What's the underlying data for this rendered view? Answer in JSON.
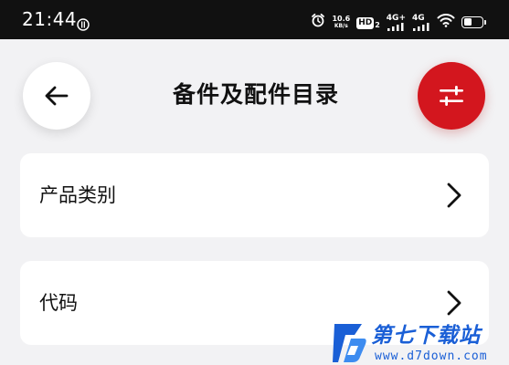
{
  "status_bar": {
    "time": "21:44",
    "net_speed_value": "10.6",
    "net_speed_unit": "KB/s",
    "hd_label": "HD",
    "hd_sub": "2",
    "signal1_label": "4G+",
    "signal2_label": "4G",
    "battery_level": 0.45,
    "icons": [
      "app-notification-icon",
      "alarm-icon",
      "wifi-icon",
      "battery-icon"
    ]
  },
  "header": {
    "title": "备件及配件目录",
    "back_icon": "arrow-left-icon",
    "filter_icon": "sliders-icon",
    "accent_color": "#d3161e"
  },
  "list": {
    "items": [
      {
        "label": "产品类别"
      },
      {
        "label": "代码"
      }
    ]
  },
  "watermark": {
    "name": "第七下载站",
    "url": "www.d7down.com",
    "color": "#1a5fd6"
  }
}
